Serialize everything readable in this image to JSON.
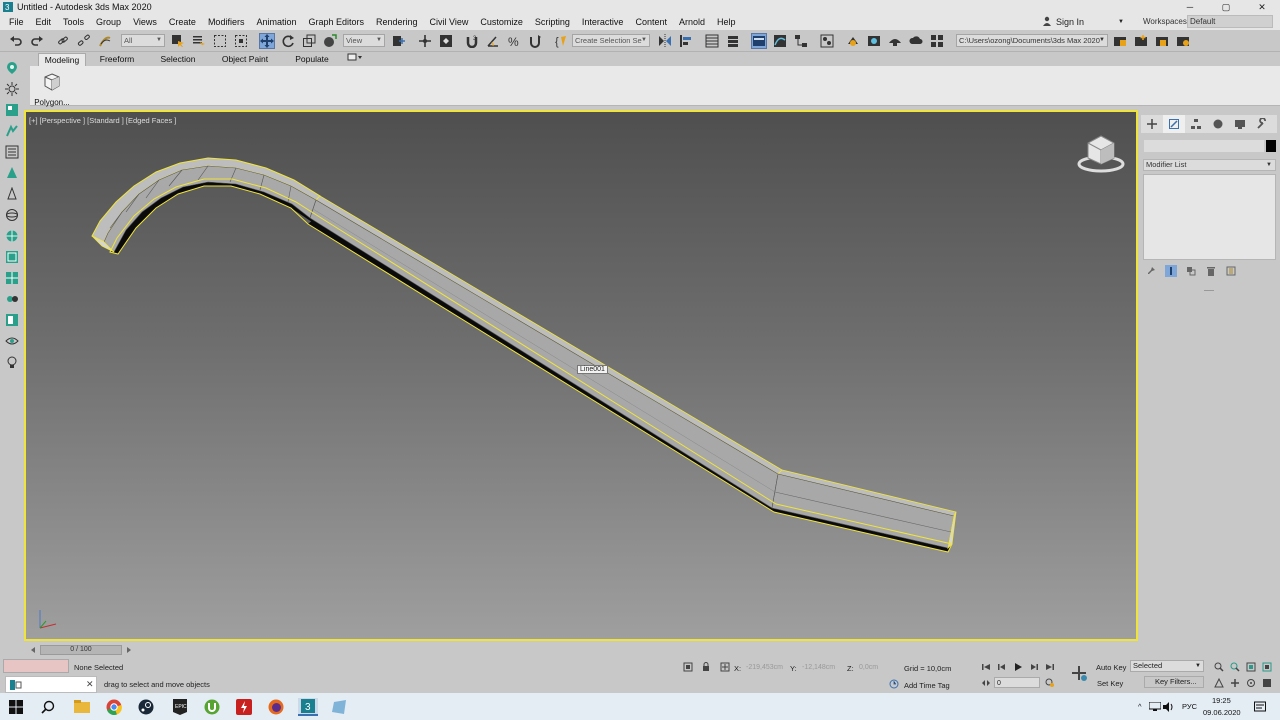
{
  "window": {
    "title": "Untitled - Autodesk 3ds Max 2020",
    "btn_min": "─",
    "btn_max": "▢",
    "btn_close": "✕"
  },
  "menu": [
    "File",
    "Edit",
    "Tools",
    "Group",
    "Views",
    "Create",
    "Modifiers",
    "Animation",
    "Graph Editors",
    "Rendering",
    "Civil View",
    "Customize",
    "Scripting",
    "Interactive",
    "Content",
    "Arnold",
    "Help"
  ],
  "account": {
    "sign_in": "Sign In",
    "workspaces_label": "Workspaces:",
    "workspace": "Default"
  },
  "toolbar": {
    "filter": "All",
    "ref_coord": "View",
    "selection_set": "Create Selection Se",
    "project_path": "C:\\Users\\ozong\\Documents\\3ds Max 2020"
  },
  "ribbon": {
    "tabs": [
      "Modeling",
      "Freeform",
      "Selection",
      "Object Paint",
      "Populate"
    ],
    "active_tab": "Modeling",
    "button_label": "Polygon..."
  },
  "viewport": {
    "label": "[+] [Perspective ] [Standard ] [Edged Faces ]",
    "object_tag": "Line001"
  },
  "command_panel": {
    "modifier_list": "Modifier List"
  },
  "timeline": {
    "frame": "0 / 100"
  },
  "status": {
    "selection": "None Selected",
    "prompt": "drag to select and move objects",
    "x_label": "X:",
    "x_value": "-219,453cm",
    "y_label": "Y:",
    "y_value": "-12,148cm",
    "z_label": "Z:",
    "z_value": "0,0cm",
    "grid": "Grid = 10,0cm",
    "add_time_tag": "Add Time Tag",
    "auto_key": "Auto Key",
    "set_key": "Set Key",
    "key_mode": "Selected",
    "key_filters": "Key Filters...",
    "frame_field": "0"
  },
  "taskbar": {
    "lang": "РУС",
    "time": "19:25",
    "date": "09.06.2020"
  },
  "colors": {
    "selection_highlight": "#f0e43a",
    "active_tool": "#7fa6d8"
  }
}
